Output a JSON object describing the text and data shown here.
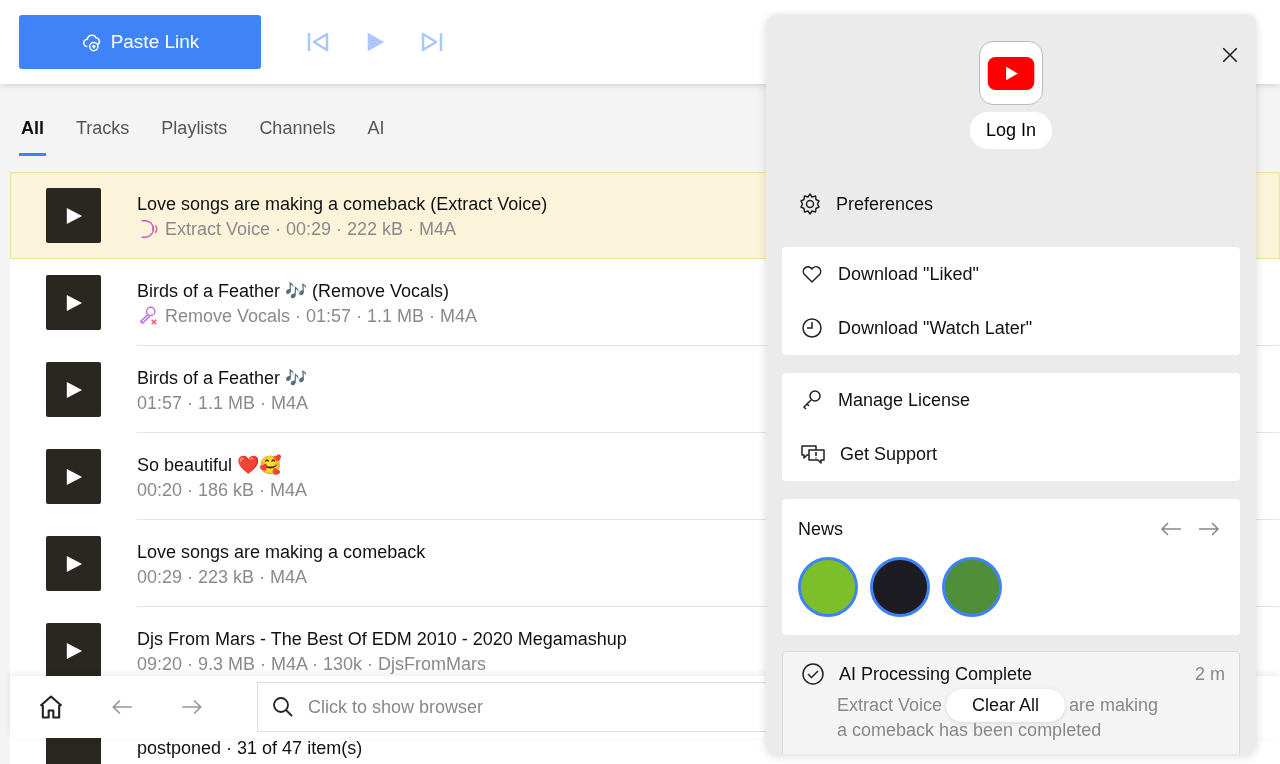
{
  "toolbar": {
    "paste_button": "Paste Link"
  },
  "tabs": [
    {
      "label": "All",
      "selected": true
    },
    {
      "label": "Tracks",
      "selected": false
    },
    {
      "label": "Playlists",
      "selected": false
    },
    {
      "label": "Channels",
      "selected": false
    },
    {
      "label": "AI",
      "selected": false
    }
  ],
  "items": [
    {
      "title": "Love songs are making a comeback (Extract Voice)",
      "meta": "Extract Voice · 00:29 · 222 kB · M4A",
      "kind": "extract-voice",
      "selected": true
    },
    {
      "title": "Birds of a Feather 🎶 (Remove Vocals)",
      "meta": "Remove Vocals · 01:57 · 1.1 MB · M4A",
      "kind": "remove-vocals",
      "selected": false
    },
    {
      "title": "Birds of a Feather 🎶",
      "meta": "01:57 · 1.1 MB · M4A",
      "kind": "plain",
      "selected": false
    },
    {
      "title": "So beautiful ❤️🥰",
      "meta": "00:20 · 186 kB · M4A",
      "kind": "plain",
      "selected": false
    },
    {
      "title": "Love songs are making a comeback",
      "meta": "00:29 · 223 kB · M4A",
      "kind": "plain",
      "selected": false
    },
    {
      "title": "Djs From Mars - The Best Of EDM 2010 - 2020 Megamashup",
      "meta": "09:20 · 9.3 MB · M4A · 130k · DjsFromMars",
      "kind": "plain",
      "selected": false
    }
  ],
  "status_line": "postponed · 31 of 47 item(s)",
  "bottom_bar": {
    "search": {
      "placeholder": "Click to show browser"
    }
  },
  "panel": {
    "login_button": "Log In",
    "preferences": "Preferences",
    "groups": [
      [
        "Download \"Liked\"",
        "Download \"Watch Later\""
      ],
      [
        "Manage License",
        "Get Support"
      ]
    ],
    "news": {
      "title": "News"
    },
    "notification": {
      "title": "AI Processing Complete",
      "time": "2 m",
      "text_before": "Extract Voice",
      "text_after": "are making",
      "text_line2": "a comeback has been completed",
      "clear_button": "Clear All"
    }
  }
}
